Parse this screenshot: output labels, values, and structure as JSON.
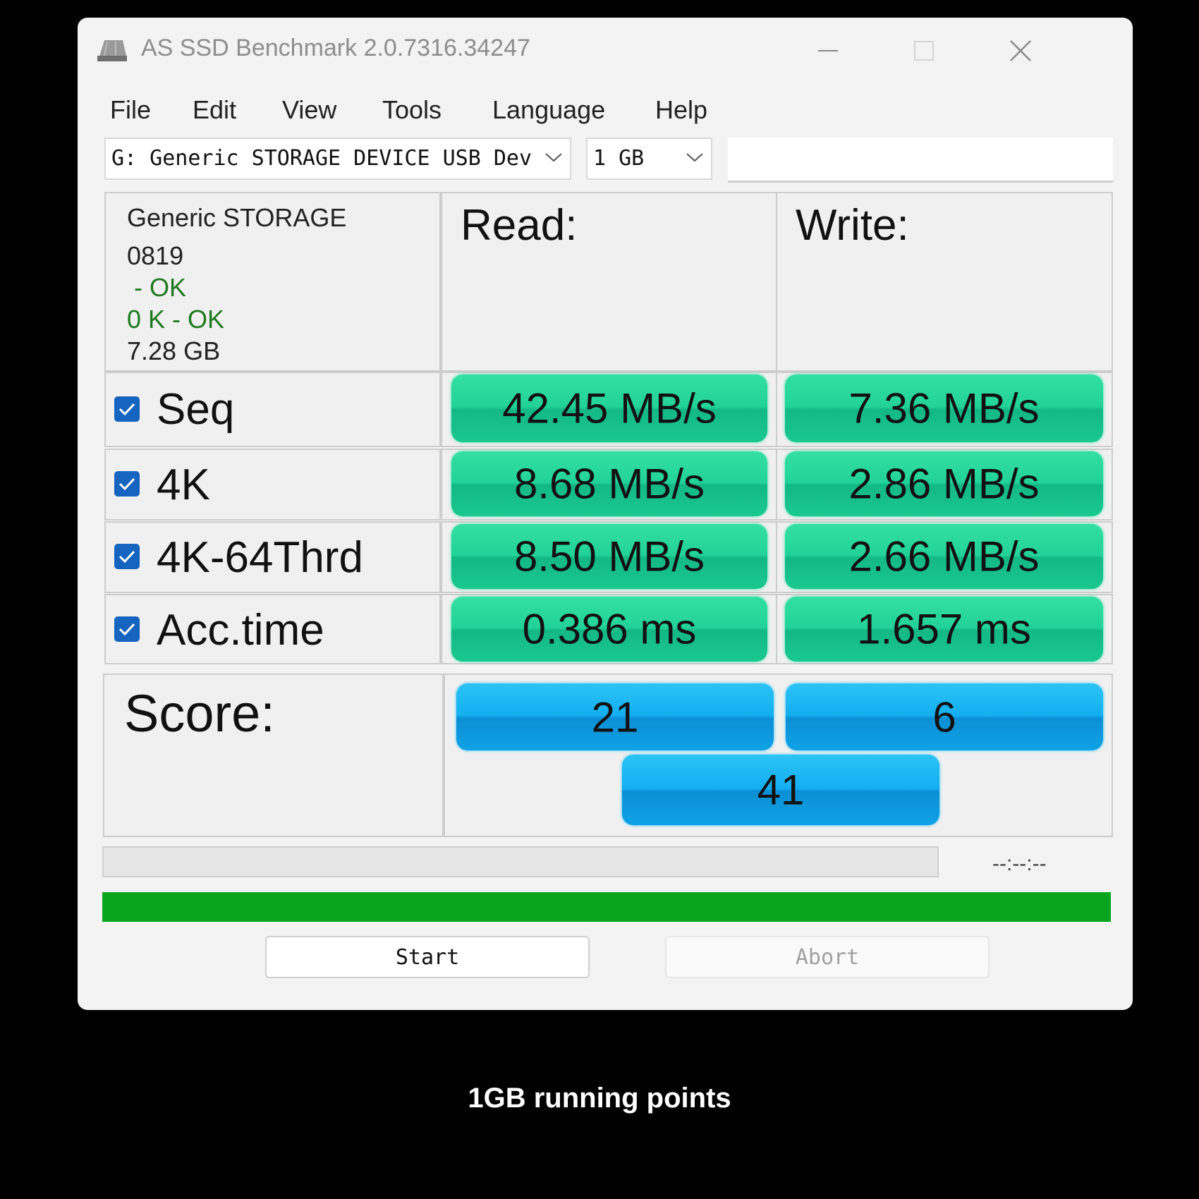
{
  "window": {
    "title": "AS SSD Benchmark 2.0.7316.34247",
    "controls": [
      "minimize-icon",
      "maximize-icon",
      "close-icon"
    ]
  },
  "menu": [
    "File",
    "Edit",
    "View",
    "Tools",
    "Language",
    "Help"
  ],
  "drive_select": {
    "value": "G: Generic STORAGE DEVICE USB Dev"
  },
  "size_select": {
    "value": "1 GB"
  },
  "device_info": {
    "name": "Generic STORAGE",
    "firmware": "0819",
    "status1": " - OK",
    "status2": "0 K - OK",
    "capacity": "7.28 GB"
  },
  "headers": {
    "read": "Read:",
    "write": "Write:"
  },
  "rows": [
    {
      "label": "Seq",
      "checked": true,
      "read": "42.45 MB/s",
      "write": "7.36 MB/s"
    },
    {
      "label": "4K",
      "checked": true,
      "read": "8.68 MB/s",
      "write": "2.86 MB/s"
    },
    {
      "label": "4K-64Thrd",
      "checked": true,
      "read": "8.50 MB/s",
      "write": "2.66 MB/s"
    },
    {
      "label": "Acc.time",
      "checked": true,
      "read": "0.386 ms",
      "write": "1.657 ms"
    }
  ],
  "score": {
    "label": "Score:",
    "read": "21",
    "write": "6",
    "total": "41"
  },
  "progress": {
    "timer": "--:--:--",
    "top_bar_fraction": 0,
    "bottom_bar_fraction": 1
  },
  "buttons": {
    "start": "Start",
    "abort": "Abort"
  },
  "caption": "1GB running points",
  "colors": {
    "result_bar": "#21d296",
    "score_bar": "#12aef0",
    "progress": "#07a61d"
  }
}
